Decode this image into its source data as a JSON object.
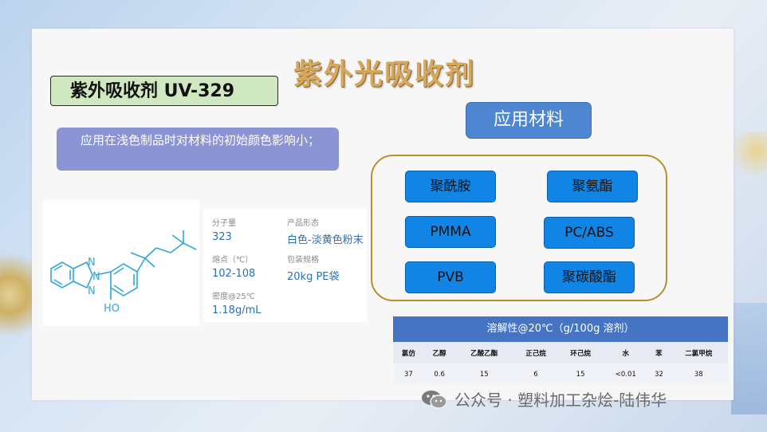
{
  "title": "紫外光吸收剂",
  "subtitle": "紫外吸收剂 UV-329",
  "note": "应用在浅色制品时对材料的初始颜色影响小；",
  "properties": [
    {
      "label": "分子量",
      "value": "323"
    },
    {
      "label": "产品形态",
      "value": "白色-淡黄色粉末"
    },
    {
      "label": "熔点（℃）",
      "value": "102-108"
    },
    {
      "label": "包装规格",
      "value": "20kg PE袋"
    },
    {
      "label": "密度@25℃",
      "value": "1.18g/mL"
    }
  ],
  "structure": {
    "n_label": "N",
    "oh_label": "HO"
  },
  "applications": {
    "heading": "应用材料",
    "items": [
      "聚酰胺",
      "聚氨酯",
      "PMMA",
      "PC/ABS",
      "PVB",
      "聚碳酸酯"
    ]
  },
  "solubility": {
    "title": "溶解性@20℃（g/100g 溶剂）",
    "solvents": [
      "氯仿",
      "乙醇",
      "乙酸乙酯",
      "正己烷",
      "环己烷",
      "水",
      "苯",
      "二氯甲烷"
    ],
    "values": [
      "37",
      "0.6",
      "15",
      "6",
      "15",
      "<0.01",
      "32",
      "38"
    ]
  },
  "watermark": "公众号 · 塑料加工杂烩-陆伟华",
  "colors": {
    "title_gold": "#d8a85a",
    "frame_gold": "#b5912e",
    "button_blue": "#1185e6",
    "header_blue": "#4674c4"
  }
}
